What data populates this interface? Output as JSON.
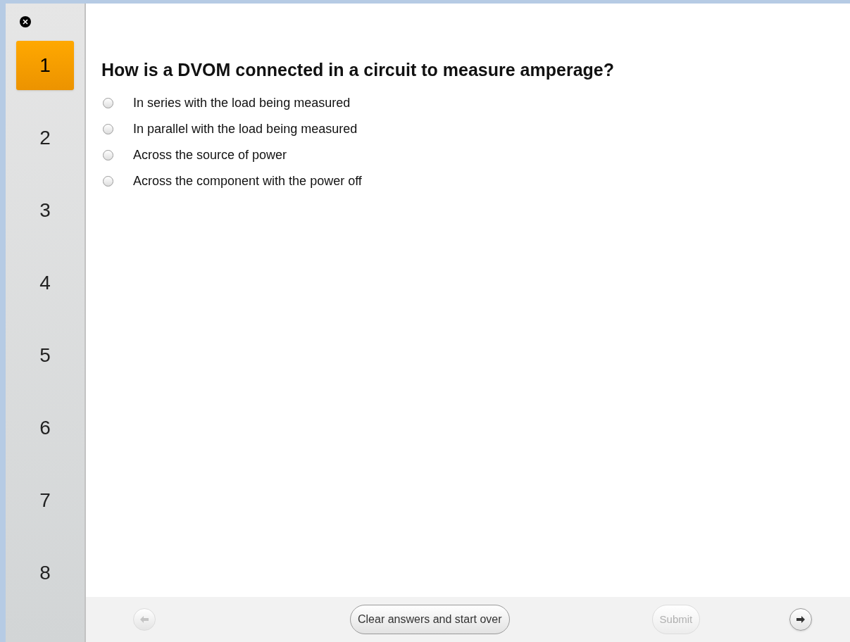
{
  "nav": {
    "questions": [
      {
        "label": "1",
        "selected": true
      },
      {
        "label": "2",
        "selected": false
      },
      {
        "label": "3",
        "selected": false
      },
      {
        "label": "4",
        "selected": false
      },
      {
        "label": "5",
        "selected": false
      },
      {
        "label": "6",
        "selected": false
      },
      {
        "label": "7",
        "selected": false
      },
      {
        "label": "8",
        "selected": false
      }
    ]
  },
  "question": {
    "text": "How is a DVOM connected in a circuit to measure amperage?",
    "options": [
      {
        "label": "In series with the load being measured",
        "selected": false
      },
      {
        "label": "In parallel with the load being measured",
        "selected": false
      },
      {
        "label": "Across the source of power",
        "selected": false
      },
      {
        "label": "Across the component with the power off",
        "selected": false
      }
    ]
  },
  "footer": {
    "back": {
      "disabled": true
    },
    "clear": {
      "label": "Clear answers and start over",
      "disabled": false
    },
    "submit": {
      "label": "Submit",
      "disabled": true
    },
    "next": {
      "disabled": false
    }
  }
}
